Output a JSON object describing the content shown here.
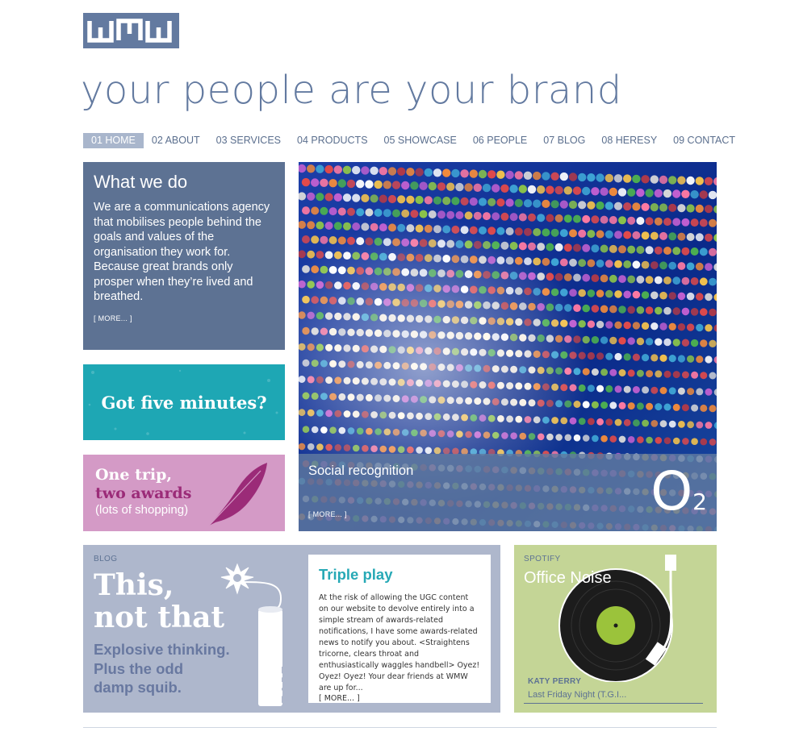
{
  "logo": {
    "text": "WMW"
  },
  "tagline": "your people are your brand",
  "nav": [
    {
      "label": "01 HOME",
      "active": true
    },
    {
      "label": "02 ABOUT"
    },
    {
      "label": "03 SERVICES"
    },
    {
      "label": "04 PRODUCTS"
    },
    {
      "label": "05 SHOWCASE"
    },
    {
      "label": "06 PEOPLE"
    },
    {
      "label": "07 BLOG"
    },
    {
      "label": "08 HERESY"
    },
    {
      "label": "09 CONTACT"
    }
  ],
  "whatwedo": {
    "title": "What we do",
    "body": "We are a communications agency that mobilises people behind the goals and values of the organisation they work for. Because great brands only prosper when they’re lived and breathed.",
    "more": "[ MORE... ]"
  },
  "fiveminutes": {
    "label": "Got five minutes?"
  },
  "onetrip": {
    "line1": "One trip,",
    "line2": "two awards",
    "line3": "(lots of shopping)"
  },
  "hero": {
    "title": "Social recognition",
    "more": "[ MORE... ]",
    "brand_o": "O",
    "brand_sub": "2"
  },
  "blog": {
    "label": "BLOG",
    "headline_1": "This,",
    "headline_2": "not that",
    "sub_1": "Explosive thinking.",
    "sub_2": "Plus the odd",
    "sub_3": "damp squib.",
    "tnt_label": "TNT",
    "post_title": "Triple play",
    "post_body": "At the risk of allowing the UGC content on our website to devolve entirely into a simple stream of awards-related notifications, I have some awards-related news to notify you about. <Straightens tricorne, clears throat and enthusiastically waggles handbell> Oyez! Oyez! Oyez! Your dear friends at WMW are up for...",
    "post_more": "[ MORE... ]"
  },
  "spotify": {
    "label": "SPOTIFY",
    "title": "Office Noise",
    "artist": "KATY PERRY",
    "track": "Last Friday Night (T.G.I..."
  },
  "colors": {
    "brand_blue": "#637aa0",
    "teal": "#1ea7b4",
    "pink": "#d49ac6",
    "magenta": "#9b2b78",
    "lavender": "#aeb7cc",
    "lime": "#c4d596"
  }
}
